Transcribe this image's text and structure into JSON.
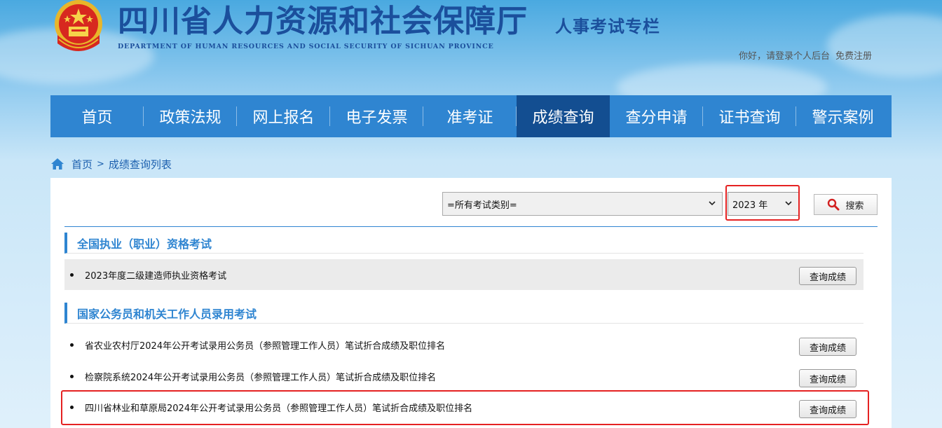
{
  "header": {
    "title": "四川省人力资源和社会保障厅",
    "subtitle": "DEPARTMENT OF HUMAN RESOURCES AND SOCIAL SECURITY OF SICHUAN PROVINCE",
    "column_title": "人事考试专栏",
    "login_link": "你好，请登录个人后台",
    "register_link": "免费注册"
  },
  "nav": {
    "items": [
      {
        "label": "首页"
      },
      {
        "label": "政策法规"
      },
      {
        "label": "网上报名"
      },
      {
        "label": "电子发票"
      },
      {
        "label": "准考证"
      },
      {
        "label": "成绩查询",
        "active": true
      },
      {
        "label": "查分申请"
      },
      {
        "label": "证书查询"
      },
      {
        "label": "警示案例"
      }
    ]
  },
  "breadcrumb": {
    "home": "首页",
    "separator": ">",
    "current": "成绩查询列表"
  },
  "filters": {
    "exam_type_selected": "=所有考试类别=",
    "year_selected": "2023 年",
    "search_label": "搜索"
  },
  "sections": [
    {
      "title": "全国执业（职业）资格考试",
      "rows": [
        {
          "title": "2023年度二级建造师执业资格考试",
          "button": "查询成绩"
        }
      ]
    },
    {
      "title": "国家公务员和机关工作人员录用考试",
      "rows": [
        {
          "title": "省农业农村厅2024年公开考试录用公务员（参照管理工作人员）笔试折合成绩及职位排名",
          "button": "查询成绩"
        },
        {
          "title": "检察院系统2024年公开考试录用公务员（参照管理工作人员）笔试折合成绩及职位排名",
          "button": "查询成绩"
        },
        {
          "title": "四川省林业和草原局2024年公开考试录用公务员（参照管理工作人员）笔试折合成绩及职位排名",
          "button": "查询成绩"
        }
      ]
    }
  ],
  "colors": {
    "nav_bg": "#2f85d1",
    "nav_active": "#134e91",
    "accent_red": "#e52222",
    "title_blue": "#1b4f9c"
  }
}
